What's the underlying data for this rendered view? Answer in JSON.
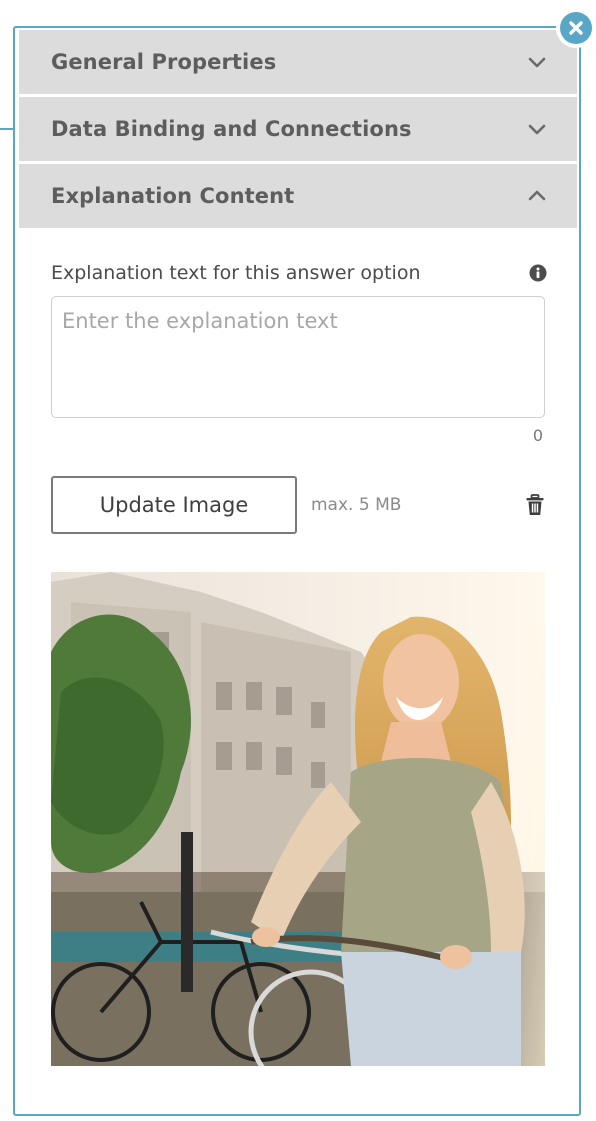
{
  "accordion": {
    "sections": [
      {
        "title": "General Properties",
        "state": "collapsed"
      },
      {
        "title": "Data Binding and Connections",
        "state": "collapsed"
      },
      {
        "title": "Explanation Content",
        "state": "expanded"
      }
    ]
  },
  "explanation": {
    "label": "Explanation text for this answer option",
    "placeholder": "Enter the explanation text",
    "value": "",
    "char_count": "0"
  },
  "image_upload": {
    "button_label": "Update Image",
    "size_hint": "max. 5 MB"
  },
  "icons": {
    "close": "close-icon",
    "collapsed": "chevron-down-icon",
    "expanded": "chevron-up-icon",
    "info": "info-icon",
    "delete": "trash-icon"
  },
  "colors": {
    "accent": "#5aa6c6",
    "header_bg": "#dcdcdc",
    "header_text": "#5d5d5d"
  }
}
